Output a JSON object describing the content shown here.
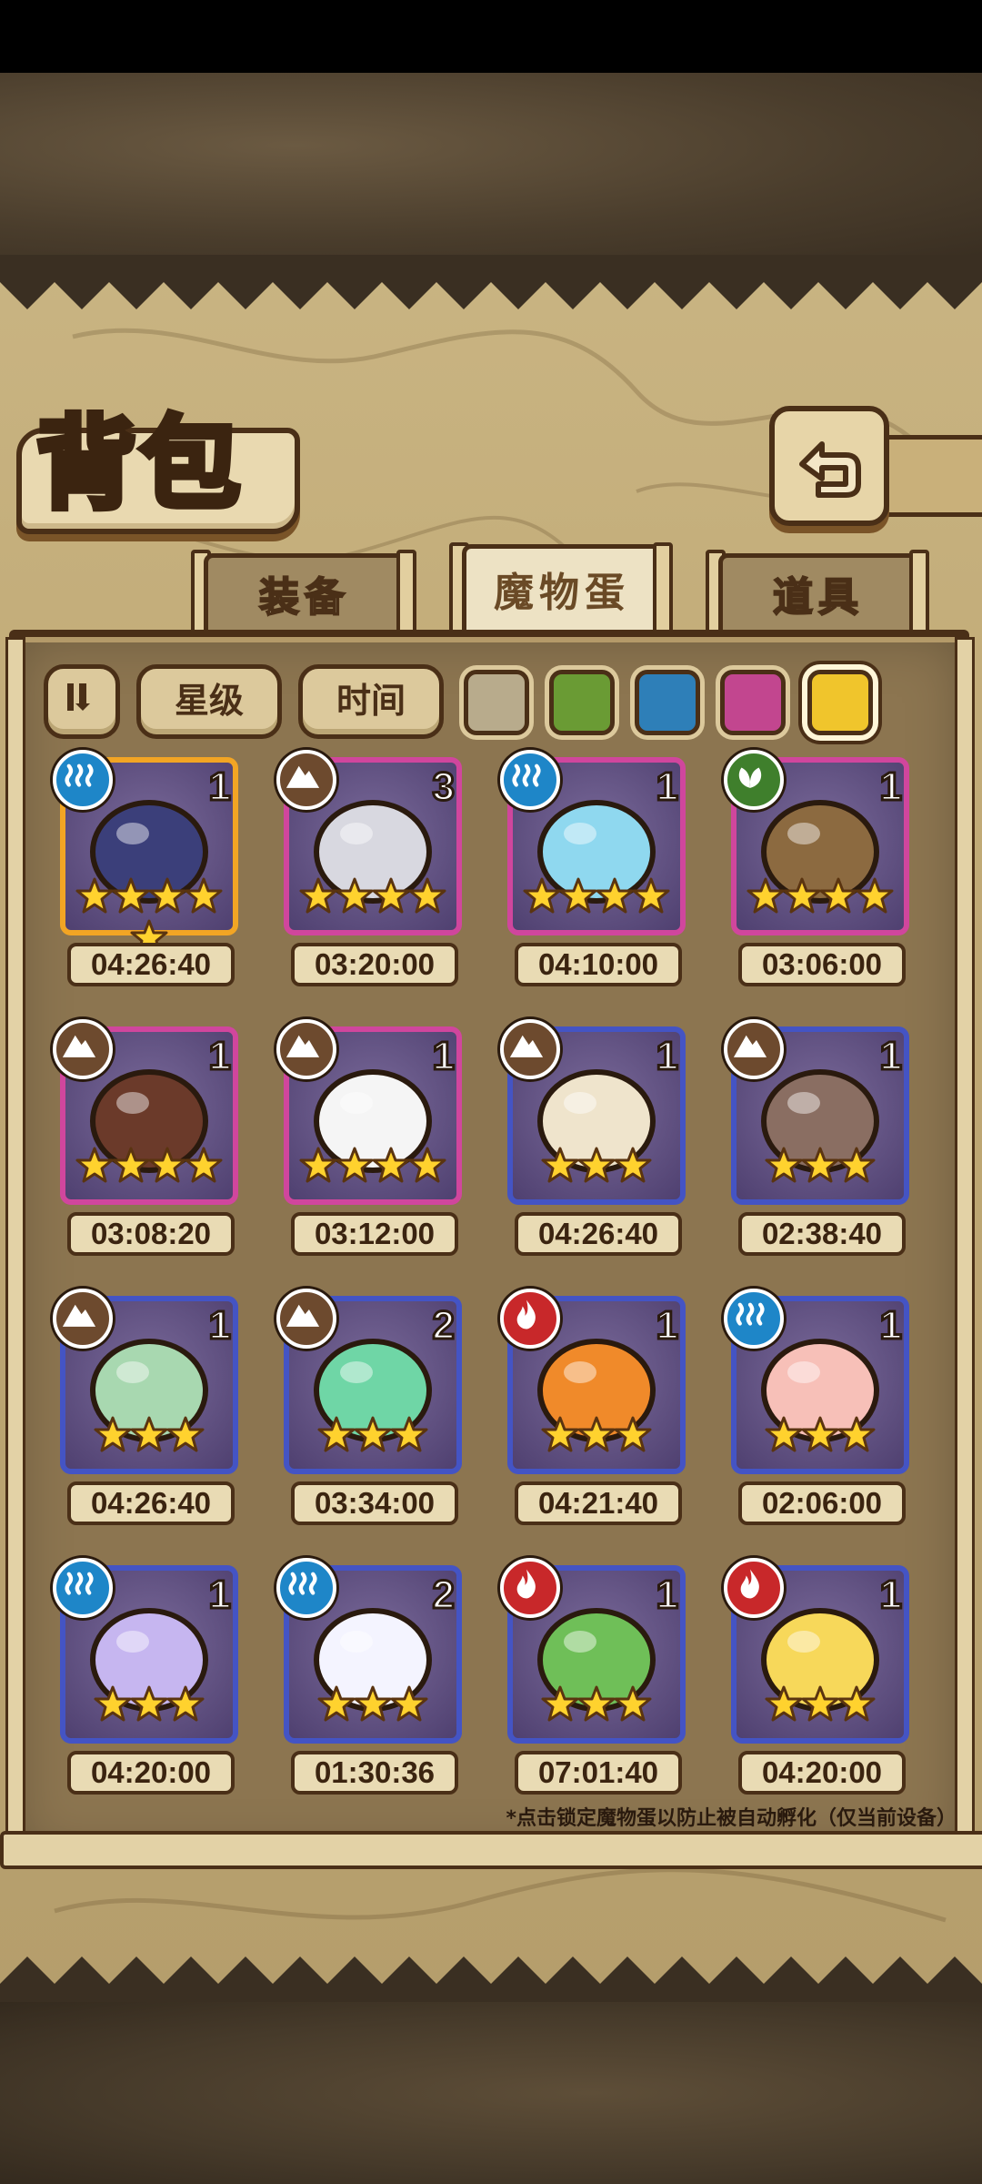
{
  "page": {
    "title": "背包"
  },
  "tabs": [
    {
      "label": "装备",
      "active": false
    },
    {
      "label": "魔物蛋",
      "active": true
    },
    {
      "label": "道具",
      "active": false
    }
  ],
  "filters": {
    "sort_icon": "sort-toggle-icon",
    "star_label": "星级",
    "time_label": "时间",
    "swatches": [
      {
        "name": "gray",
        "color": "#b8ab8c",
        "selected": false
      },
      {
        "name": "green",
        "color": "#6a9b34",
        "selected": false
      },
      {
        "name": "blue",
        "color": "#2e7fb8",
        "selected": false
      },
      {
        "name": "pink",
        "color": "#c2468f",
        "selected": false
      },
      {
        "name": "yellow",
        "color": "#f0c52c",
        "selected": true
      }
    ]
  },
  "eggs": [
    {
      "count": "1",
      "timer": "04:26:40",
      "stars": 5,
      "rarity": "gold",
      "element": "water"
    },
    {
      "count": "3",
      "timer": "03:20:00",
      "stars": 4,
      "rarity": "pink",
      "element": "earth"
    },
    {
      "count": "1",
      "timer": "04:10:00",
      "stars": 4,
      "rarity": "pink",
      "element": "water"
    },
    {
      "count": "1",
      "timer": "03:06:00",
      "stars": 4,
      "rarity": "pink",
      "element": "wood"
    },
    {
      "count": "1",
      "timer": "03:08:20",
      "stars": 4,
      "rarity": "pink",
      "element": "earth"
    },
    {
      "count": "1",
      "timer": "03:12:00",
      "stars": 4,
      "rarity": "pink",
      "element": "earth"
    },
    {
      "count": "1",
      "timer": "04:26:40",
      "stars": 3,
      "rarity": "blue",
      "element": "earth"
    },
    {
      "count": "1",
      "timer": "02:38:40",
      "stars": 3,
      "rarity": "blue",
      "element": "earth"
    },
    {
      "count": "1",
      "timer": "04:26:40",
      "stars": 3,
      "rarity": "blue",
      "element": "earth"
    },
    {
      "count": "2",
      "timer": "03:34:00",
      "stars": 3,
      "rarity": "blue",
      "element": "earth"
    },
    {
      "count": "1",
      "timer": "04:21:40",
      "stars": 3,
      "rarity": "blue",
      "element": "fire"
    },
    {
      "count": "1",
      "timer": "02:06:00",
      "stars": 3,
      "rarity": "blue",
      "element": "water"
    },
    {
      "count": "1",
      "timer": "04:20:00",
      "stars": 3,
      "rarity": "blue",
      "element": "water"
    },
    {
      "count": "2",
      "timer": "01:30:36",
      "stars": 3,
      "rarity": "blue",
      "element": "water"
    },
    {
      "count": "1",
      "timer": "07:01:40",
      "stars": 3,
      "rarity": "blue",
      "element": "fire"
    },
    {
      "count": "1",
      "timer": "04:20:00",
      "stars": 3,
      "rarity": "blue",
      "element": "fire"
    }
  ],
  "colors": {
    "rarity": {
      "gold": "#f2a524",
      "pink": "#d0469d",
      "blue": "#4454c4"
    },
    "element": {
      "water": "#1e86c8",
      "earth": "#6d4a2e",
      "wood": "#3f7f2c",
      "fire": "#c8282a"
    }
  },
  "footer_note": "*点击锁定魔物蛋以防止被自动孵化（仅当前设备）"
}
